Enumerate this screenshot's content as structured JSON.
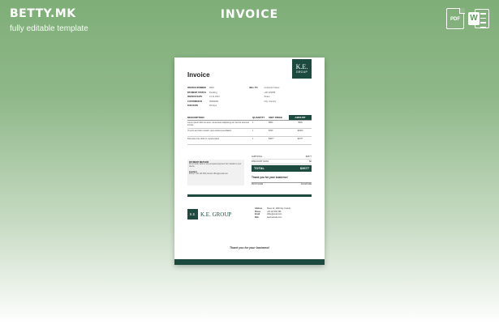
{
  "brand": {
    "logo": "BETTY.MK",
    "tagline": "fully editable template"
  },
  "heading": "INVOICE",
  "formats": {
    "pdf_label": "PDF",
    "word_label": "W"
  },
  "colors": {
    "accent": "#1d4a3e",
    "background_top": "#7fae78"
  },
  "doc": {
    "logo": {
      "initials": "K.E.",
      "word": "GROUP"
    },
    "title": "Invoice",
    "meta": {
      "labels": [
        "INVOICE NUMBER",
        "PAYMENT STATUS",
        "INVOICE DATE",
        "CUSTOMER ID",
        "DUE DATE"
      ],
      "values": [
        "0001",
        "Pending",
        "12.11.2021",
        "00000001",
        "30 days"
      ]
    },
    "bill_to": {
      "labels": [
        "BILL TO",
        "",
        "",
        ""
      ],
      "values": [
        "Customer Name",
        "+00 123456",
        "Street",
        "City, Country"
      ]
    },
    "columns": {
      "desc": "DESCRIPTION",
      "qty": "QUANTITY",
      "price": "UNIT PRICE",
      "amount": "AMOUNT"
    },
    "items": [
      {
        "desc": "Lorem ipsum dolor sit amet, consectetur adipiscing elit, sed do eiusmod tempor",
        "qty": "1",
        "price": "$500",
        "amount": "$500"
      },
      {
        "desc": "Ut enim ad minim veniam, quis nostrud exercitation",
        "qty": "1",
        "price": "$750",
        "amount": "$1500"
      },
      {
        "desc": "Duis aute irure dolor in reprehenderit",
        "qty": "1",
        "price": "$1677",
        "amount": "$1677"
      }
    ],
    "payment": {
      "method_title": "PAYMENT METHOD",
      "method_body": "Put in bank, bank or any accepted payment form details to your clients",
      "contact_title": "Contact",
      "contact_body": "Phone: +00 123 456 | Email: office@email.com"
    },
    "totals": {
      "subtotal_label": "SUBTOTAL",
      "subtotal": "$3677",
      "discount_label": "DISCOUNT (10%)",
      "discount": "$0",
      "total_label": "TOTAL",
      "total": "$3677"
    },
    "thanks_side": "Thank you for your business!",
    "sign_left": "PRINT NAME",
    "sign_right": "SIGNATURE",
    "footer": {
      "company": "K.E. GROUP",
      "initials": "K.E.",
      "labels": [
        "Address",
        "Phone",
        "Email",
        "Web"
      ],
      "values": [
        "Street 12, 1000 City, Country",
        "+00 123 456 789",
        "office@email.com",
        "www.website.com"
      ]
    },
    "thanks_foot": "Thank you for your business!"
  }
}
